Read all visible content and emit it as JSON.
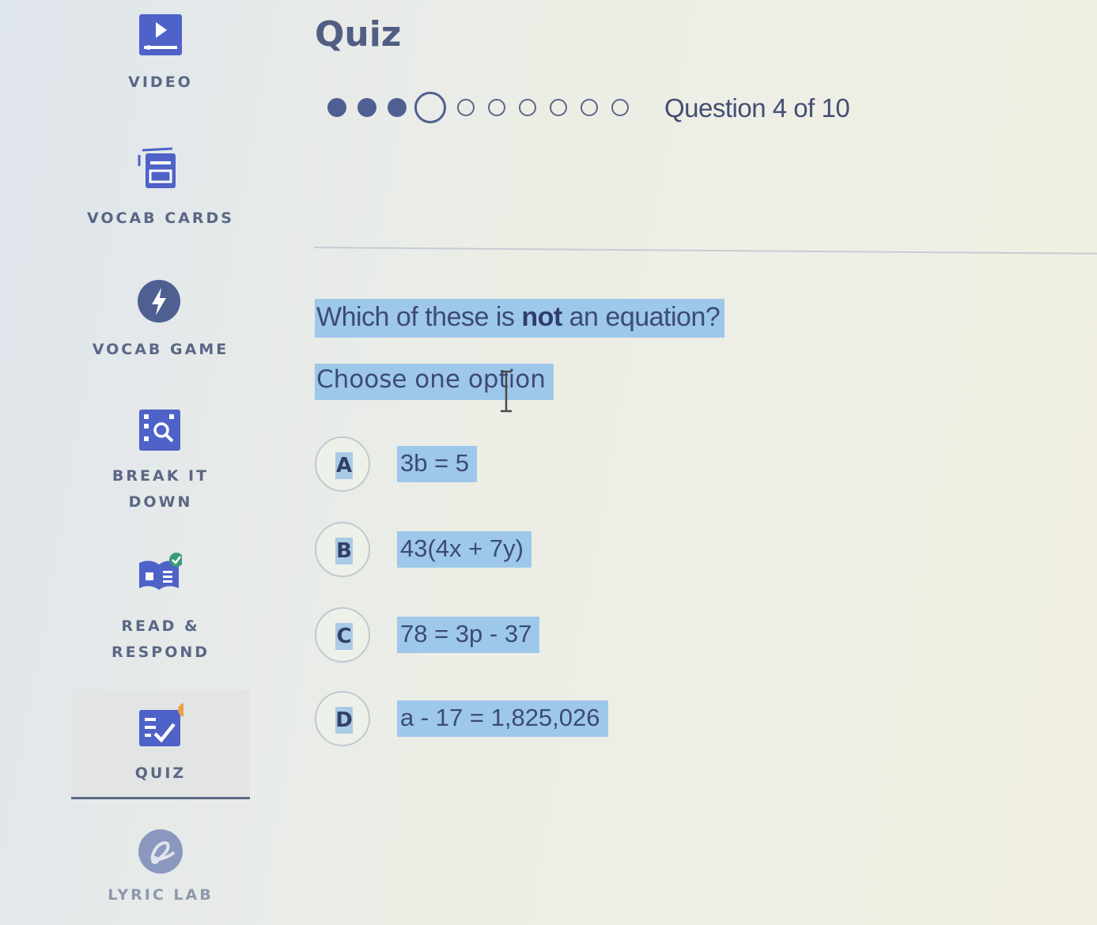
{
  "sidebar": {
    "items": [
      {
        "label": "VIDEO",
        "icon": "video-icon"
      },
      {
        "label": "VOCAB CARDS",
        "icon": "vocab-cards-icon"
      },
      {
        "label": "VOCAB GAME",
        "icon": "lightning-icon"
      },
      {
        "label": "BREAK IT\nDOWN",
        "icon": "break-it-down-icon"
      },
      {
        "label": "READ &\nRESPOND",
        "icon": "book-icon"
      },
      {
        "label": "QUIZ",
        "icon": "quiz-icon",
        "active": true
      },
      {
        "label": "LYRIC LAB",
        "icon": "lyric-lab-icon"
      }
    ]
  },
  "main": {
    "title": "Quiz",
    "progress": {
      "current": 4,
      "total": 10,
      "text": "Question 4 of 10"
    },
    "question": {
      "prefix": "Which of these is ",
      "emphasis": "not",
      "suffix": " an equation?"
    },
    "instruction": "Choose one option",
    "options": [
      {
        "letter": "A",
        "text": "3b = 5"
      },
      {
        "letter": "B",
        "text": "43(4x + 7y)"
      },
      {
        "letter": "C",
        "text": "78 = 3p - 37"
      },
      {
        "letter": "D",
        "text": "a - 17 = 1,825,026"
      }
    ]
  },
  "colors": {
    "accent": "#4f5f92",
    "selection_highlight": "#9dc8ea",
    "icon_blue": "#4e62c8",
    "notification_orange": "#e8a04a",
    "check_green": "#3a9a77"
  }
}
